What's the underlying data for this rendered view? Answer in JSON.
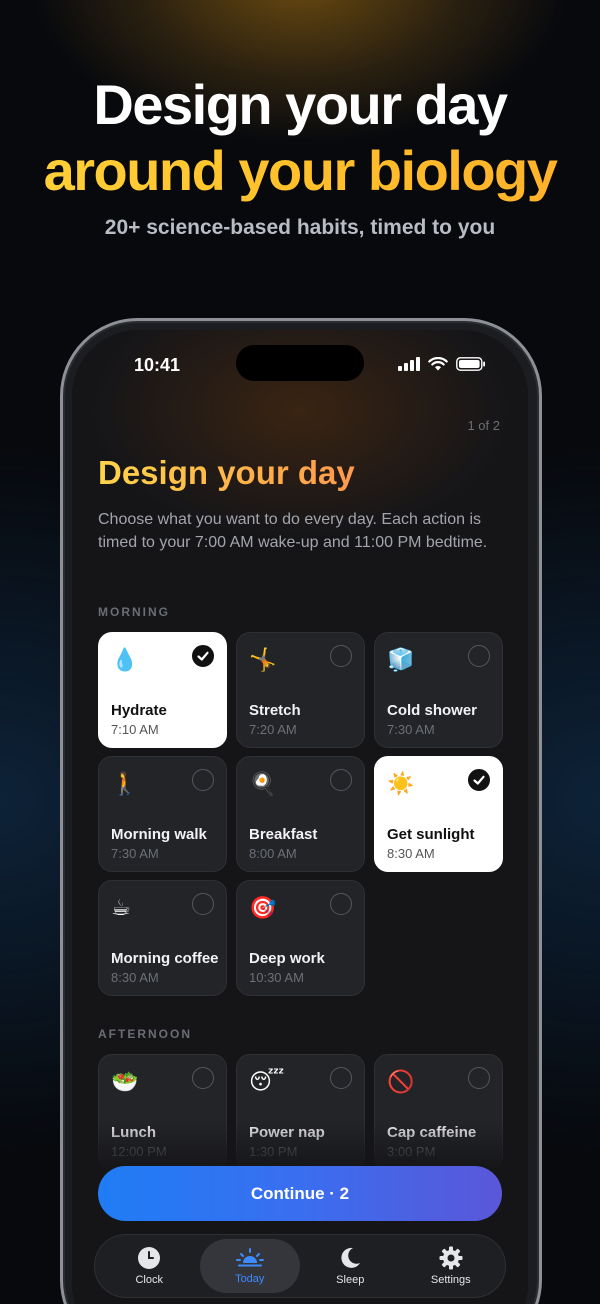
{
  "hero": {
    "title_line1": "Design your day",
    "title_line2": "around your biology",
    "subtitle": "20+ science-based habits, timed to you"
  },
  "status_bar": {
    "time": "10:41"
  },
  "screen": {
    "step": "1 of 2",
    "title": "Design your day",
    "description": "Choose what you want to do every day. Each action is timed to your 7:00 AM wake-up and 11:00 PM bedtime."
  },
  "sections": {
    "morning": {
      "label": "MORNING",
      "items": [
        {
          "emoji": "💧",
          "name": "Hydrate",
          "time": "7:10 AM",
          "selected": true
        },
        {
          "emoji": "🤸",
          "name": "Stretch",
          "time": "7:20 AM",
          "selected": false
        },
        {
          "emoji": "🧊",
          "name": "Cold shower",
          "time": "7:30 AM",
          "selected": false
        },
        {
          "emoji": "🚶",
          "name": "Morning walk",
          "time": "7:30 AM",
          "selected": false
        },
        {
          "emoji": "🍳",
          "name": "Breakfast",
          "time": "8:00 AM",
          "selected": false
        },
        {
          "emoji": "☀️",
          "name": "Get sunlight",
          "time": "8:30 AM",
          "selected": true
        },
        {
          "emoji": "☕",
          "name": "Morning coffee",
          "time": "8:30 AM",
          "selected": false
        },
        {
          "emoji": "🎯",
          "name": "Deep work",
          "time": "10:30 AM",
          "selected": false
        }
      ]
    },
    "afternoon": {
      "label": "AFTERNOON",
      "items": [
        {
          "emoji": "🥗",
          "name": "Lunch",
          "time": "12:00 PM",
          "selected": false
        },
        {
          "emoji": "😴",
          "name": "Power nap",
          "time": "1:30 PM",
          "selected": false
        },
        {
          "emoji": "🚫",
          "name": "Cap caffeine",
          "time": "3:00 PM",
          "selected": false
        }
      ]
    }
  },
  "continue_label": "Continue · 2",
  "tabs": [
    {
      "label": "Clock",
      "icon": "clock-icon",
      "active": false
    },
    {
      "label": "Today",
      "icon": "sunrise-icon",
      "active": true
    },
    {
      "label": "Sleep",
      "icon": "moon-icon",
      "active": false
    },
    {
      "label": "Settings",
      "icon": "gear-icon",
      "active": false
    }
  ],
  "colors": {
    "accent_blue": "#3d8bff",
    "title_gradient_start": "#ffd44a",
    "title_gradient_end": "#ff9a4e",
    "button_gradient_start": "#1f7df5",
    "button_gradient_end": "#5a57d8"
  }
}
